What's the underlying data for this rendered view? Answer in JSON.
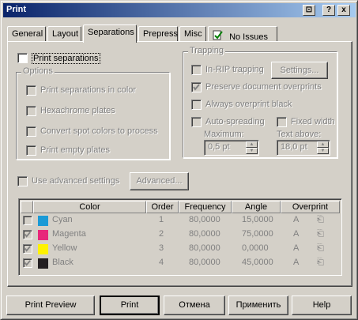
{
  "window": {
    "title": "Print",
    "controls": [
      "?",
      "x"
    ]
  },
  "tabs": [
    {
      "label": "General"
    },
    {
      "label": "Layout"
    },
    {
      "label": "Separations"
    },
    {
      "label": "Prepress"
    },
    {
      "label": "Misc"
    },
    {
      "label": "No Issues",
      "icon": "checkmark-document-icon"
    }
  ],
  "active_tab": "Separations",
  "separations": {
    "print_separations": {
      "label": "Print separations",
      "checked": false
    },
    "options": {
      "title": "Options",
      "items": [
        {
          "label": "Print separations in color",
          "checked": false,
          "enabled": false
        },
        {
          "label": "Hexachrome plates",
          "checked": false,
          "enabled": false
        },
        {
          "label": "Convert spot colors to process",
          "checked": false,
          "enabled": false
        },
        {
          "label": "Print empty plates",
          "checked": false,
          "enabled": false
        }
      ]
    },
    "trapping": {
      "title": "Trapping",
      "in_rip": {
        "label": "In-RIP trapping",
        "checked": false,
        "enabled": false
      },
      "settings_button": "Settings...",
      "preserve": {
        "label": "Preserve document overprints",
        "checked": true,
        "enabled": false
      },
      "always_black": {
        "label": "Always overprint black",
        "checked": false,
        "enabled": false
      },
      "auto_spreading": {
        "label": "Auto-spreading",
        "checked": false,
        "enabled": false
      },
      "fixed_width": {
        "label": "Fixed width",
        "checked": false,
        "enabled": false
      },
      "maximum": {
        "label": "Maximum:",
        "value": "0,5 pt"
      },
      "text_above": {
        "label": "Text above:",
        "value": "18,0 pt"
      }
    },
    "advanced": {
      "label": "Use advanced settings",
      "checked": false,
      "enabled": false,
      "button": "Advanced..."
    },
    "table": {
      "headers": [
        "Color",
        "Order",
        "Frequency",
        "Angle",
        "Overprint"
      ],
      "rows": [
        {
          "checked": false,
          "color": "Cyan",
          "swatch": "#1a9ad6",
          "order": "1",
          "frequency": "80,0000",
          "angle": "15,0000"
        },
        {
          "checked": true,
          "color": "Magenta",
          "swatch": "#e8267a",
          "order": "2",
          "frequency": "80,0000",
          "angle": "75,0000"
        },
        {
          "checked": true,
          "color": "Yellow",
          "swatch": "#fff200",
          "order": "3",
          "frequency": "80,0000",
          "angle": "0,0000"
        },
        {
          "checked": true,
          "color": "Black",
          "swatch": "#231f20",
          "order": "4",
          "frequency": "80,0000",
          "angle": "45,0000"
        }
      ]
    }
  },
  "buttons": {
    "preview": "Print Preview",
    "print": "Print",
    "cancel": "Отмена",
    "apply": "Применить",
    "help": "Help"
  }
}
